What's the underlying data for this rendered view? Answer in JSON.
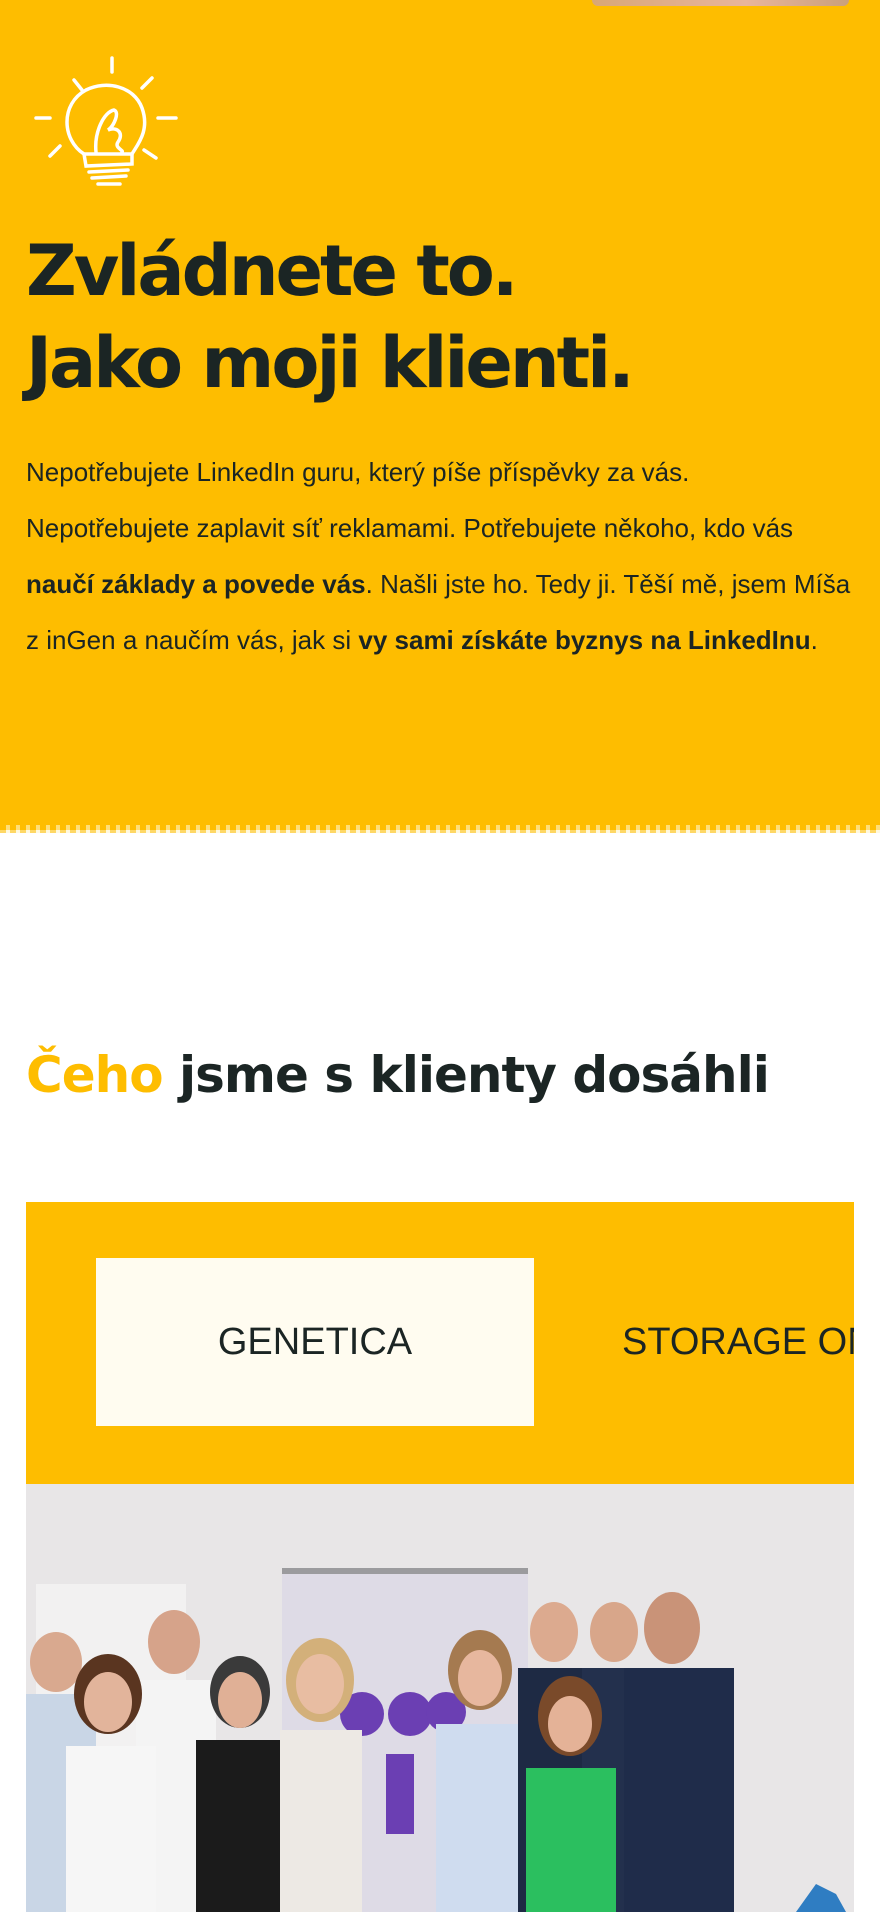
{
  "hero": {
    "title_line1": "Zvládnete to.",
    "title_line2": "Jako moji klienti.",
    "text_part1": "Nepotřebujete LinkedIn guru, který píše příspěvky za vás. Nepotřebujete zaplavit síť reklamami. Potřebujete někoho, kdo vás ",
    "text_bold1": "naučí základy a povede vás",
    "text_part2": ". Našli jste ho. Tedy ji. Těší mě, jsem Míša z inGen a naučím vás, jak si ",
    "text_bold2": "vy sami získáte byznys na LinkedInu",
    "text_part3": ".",
    "icon": "lightbulb-icon"
  },
  "results": {
    "title_accent": "Čeho",
    "title_rest": " jsme s klienty dosáhli",
    "tabs": [
      {
        "label": "GENETICA",
        "active": true
      },
      {
        "label": "STORAGE ON",
        "active": false
      }
    ],
    "photo_icon": "team-photo"
  },
  "colors": {
    "accent": "#febd00",
    "text": "#1b2524",
    "tab_active_bg": "#fffcf0",
    "background": "#ffffff"
  }
}
